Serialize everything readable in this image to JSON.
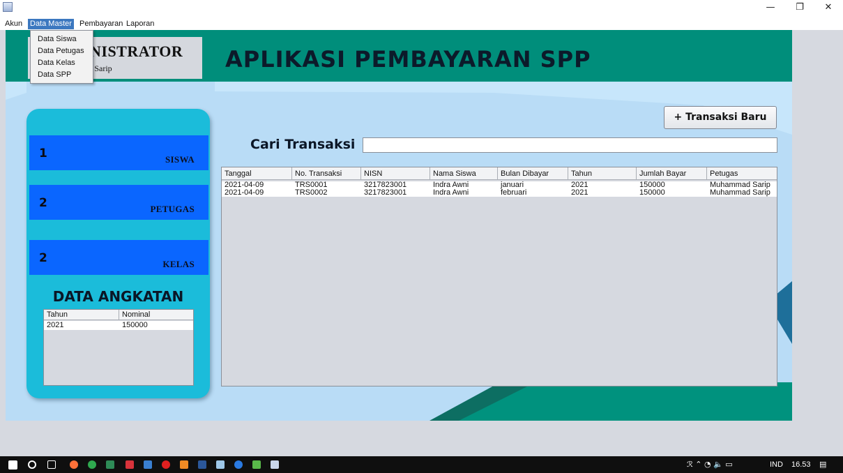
{
  "menu": {
    "items": [
      "Akun",
      "Data Master",
      "Pembayaran",
      "Laporan"
    ],
    "dropdown": [
      "Data Siswa",
      "Data Petugas",
      "Data Kelas",
      "Data SPP"
    ]
  },
  "header": {
    "admin_title": "NISTRATOR",
    "admin_name": "l Sarip",
    "app_title": "APLIKASI PEMBAYARAN SPP"
  },
  "stats": [
    {
      "value": "1",
      "label": "SISWA"
    },
    {
      "value": "2",
      "label": "PETUGAS"
    },
    {
      "value": "2",
      "label": "KELAS"
    }
  ],
  "angkatan": {
    "title": "DATA ANGKATAN",
    "columns": [
      "Tahun",
      "Nominal"
    ],
    "rows": [
      [
        "2021",
        "150000"
      ]
    ]
  },
  "actions": {
    "new_transaction": "+ Transaksi Baru",
    "search_label": "Cari Transaksi",
    "search_value": ""
  },
  "transactions": {
    "columns": [
      "Tanggal",
      "No. Transaksi",
      "NISN",
      "Nama Siswa",
      "Bulan Dibayar",
      "Tahun",
      "Jumlah Bayar",
      "Petugas"
    ],
    "rows": [
      [
        "2021-04-09",
        "TRS0001",
        "3217823001",
        "Indra Awni",
        "januari",
        "2021",
        "150000",
        "Muhammad Sarip"
      ],
      [
        "2021-04-09",
        "TRS0002",
        "3217823001",
        "Indra Awni",
        "februari",
        "2021",
        "150000",
        "Muhammad Sarip"
      ]
    ]
  },
  "window": {
    "minimize": "—",
    "maximize": "❐",
    "close": "✕"
  },
  "tray": {
    "lang": "IND",
    "time": "16.53"
  },
  "colors": {
    "header_band": "#008e7b",
    "canvas": "#b9dcf6",
    "left_panel": "#1bbcda",
    "stat_box": "#0a66ff",
    "menu_highlight": "#3c78c0"
  }
}
